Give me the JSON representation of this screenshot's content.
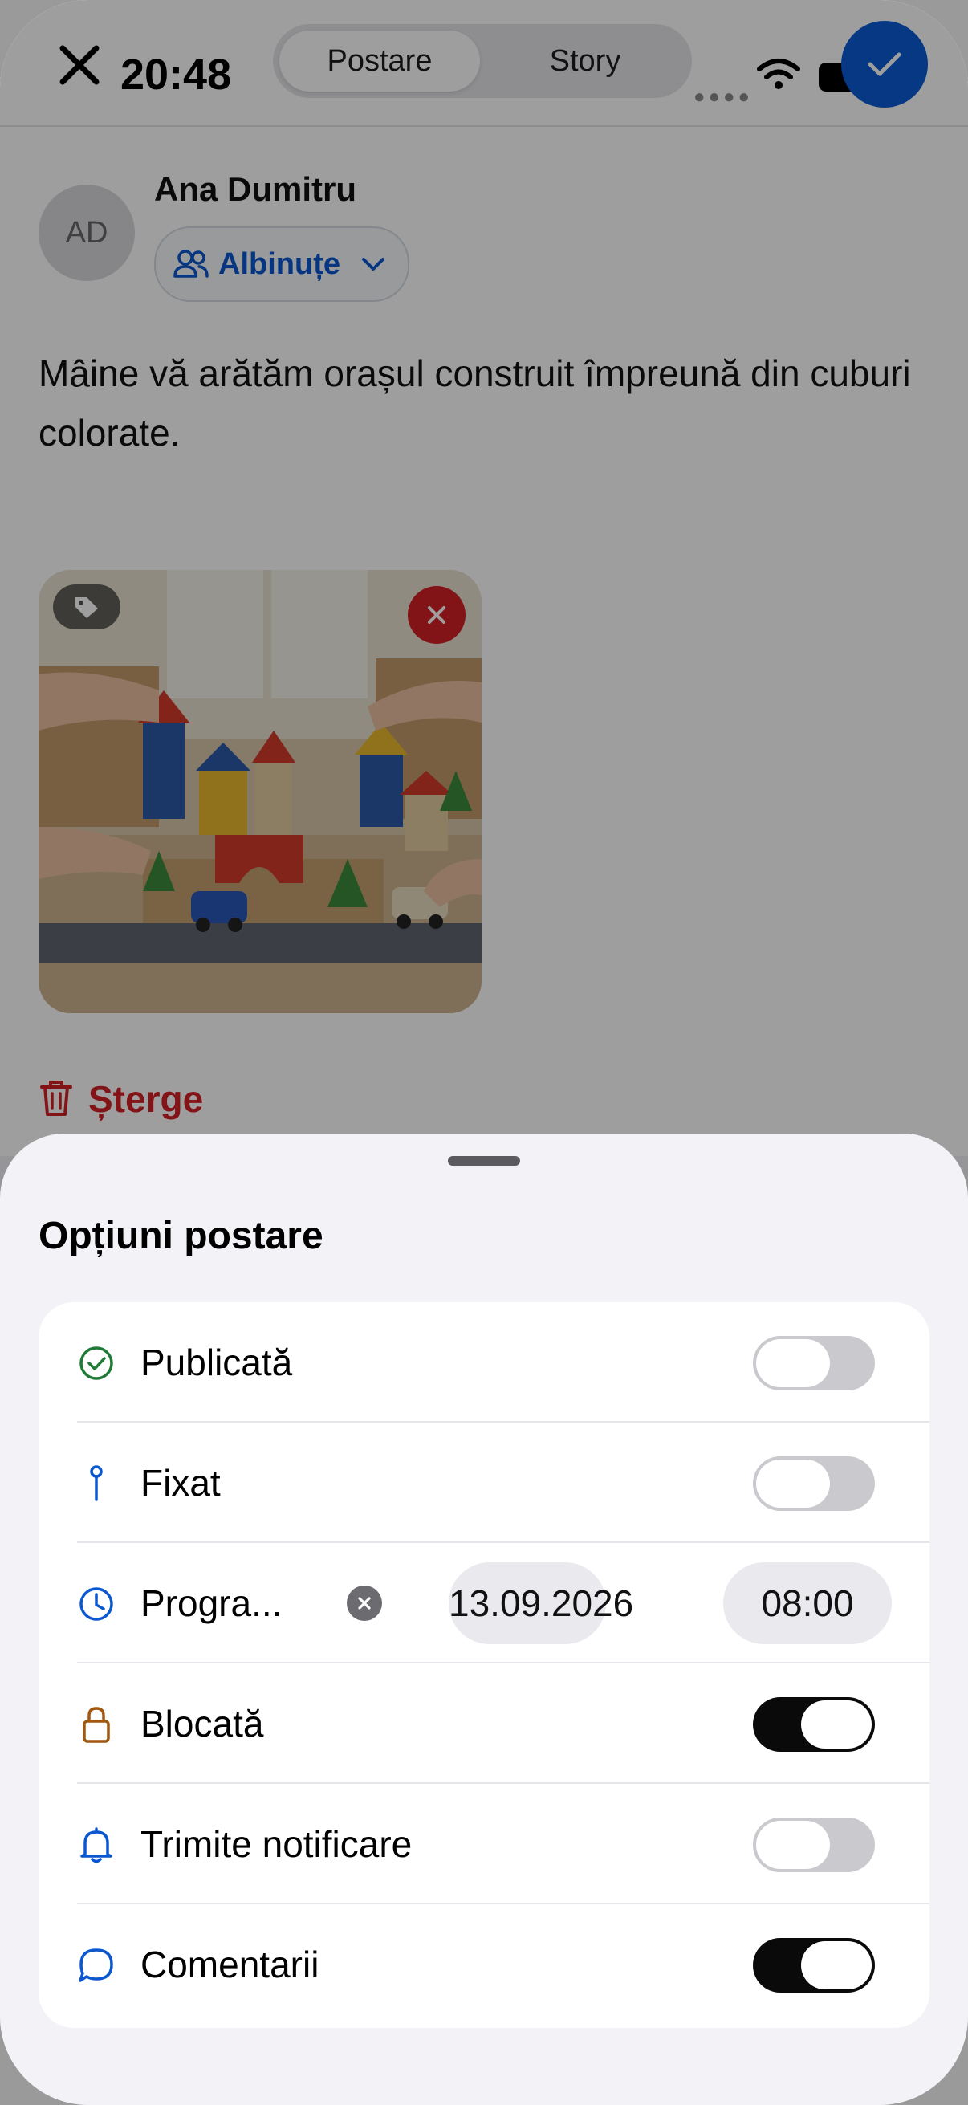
{
  "status_bar": {
    "time": "20:48"
  },
  "header": {
    "tabs": [
      {
        "label": "Postare",
        "selected": true
      },
      {
        "label": "Story",
        "selected": false
      }
    ],
    "accent_color": "#0a5bd6"
  },
  "post": {
    "author": {
      "initials": "AD",
      "name": "Ana Dumitru"
    },
    "audience_label": "Albinuțe",
    "text": "Mâine vă arătăm orașul construit împreună din cuburi colorate.",
    "delete_label": "Șterge"
  },
  "options_sheet": {
    "title": "Opțiuni postare",
    "rows": [
      {
        "label": "Publicată",
        "icon": "check-circle-icon",
        "on": false
      },
      {
        "label": "Fixat",
        "icon": "pin-icon",
        "on": false
      },
      {
        "label": "Progra...",
        "icon": "clock-icon",
        "date": "13.09.2026",
        "time": "08:00"
      },
      {
        "label": "Blocată",
        "icon": "lock-icon",
        "on": true
      },
      {
        "label": "Trimite notificare",
        "icon": "bell-icon",
        "on": false
      },
      {
        "label": "Comentarii",
        "icon": "comment-icon",
        "on": true
      }
    ]
  }
}
